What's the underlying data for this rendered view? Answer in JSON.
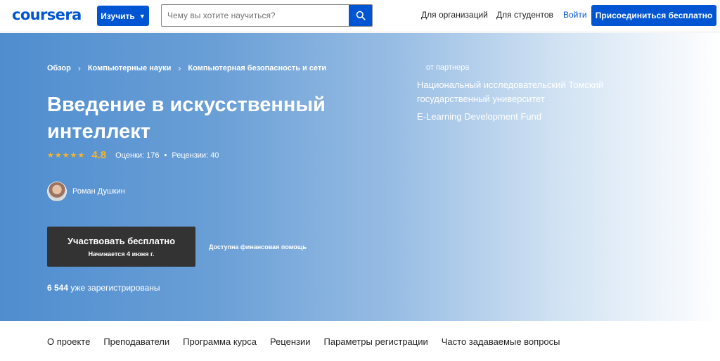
{
  "header": {
    "logo": "coursera",
    "explore_label": "Изучить",
    "search_placeholder": "Чему вы хотите научиться?",
    "links": [
      "Для организаций",
      "Для студентов",
      "Войти"
    ],
    "join_label": "Присоединиться бесплатно"
  },
  "hero": {
    "breadcrumb": [
      "Обзор",
      "Компьютерные науки",
      "Компьютерная безопасность и сети"
    ],
    "title": "Введение в искусственный интеллект",
    "rating": {
      "stars": 5,
      "value": "4.8",
      "ratings_text": "Оценки: 176",
      "reviews_text": "Рецензии: 40"
    },
    "instructor": "Роман Душкин",
    "enroll": {
      "label": "Участвовать бесплатно",
      "sub": "Начинается 4 июня г."
    },
    "aid_link": "Доступна финансовая помощь",
    "enrolled_count": "6 544",
    "enrolled_text": "уже зарегистрированы",
    "partner_label": "от партнера",
    "partners": [
      "Национальный исследовательский Томский государственный университет",
      "E-Learning Development Fund"
    ]
  },
  "tabs": [
    "О проекте",
    "Преподаватели",
    "Программа курса",
    "Рецензии",
    "Параметры регистрации",
    "Часто задаваемые вопросы"
  ],
  "colors": {
    "brand": "#0056d2",
    "star": "#f5b42a",
    "enroll_button": "#333333"
  }
}
